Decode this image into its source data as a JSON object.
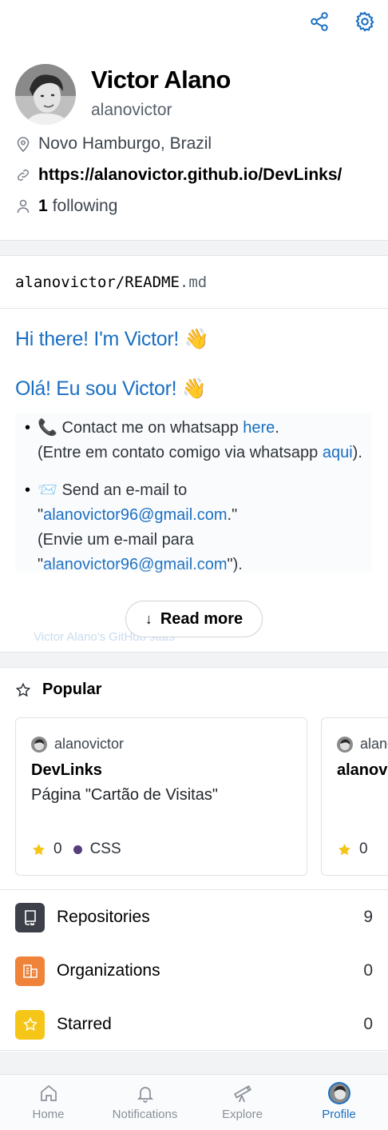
{
  "header": {
    "share_icon": "share-icon",
    "settings_icon": "gear-icon"
  },
  "profile": {
    "name": "Victor Alano",
    "username": "alanovictor",
    "location": "Novo Hamburgo, Brazil",
    "website": "https://alanovictor.github.io/DevLinks/",
    "following_count": "1",
    "following_label": "following"
  },
  "readme": {
    "path_main": "alanovictor/README",
    "path_ext": ".md",
    "heading_en": "Hi there! I'm Victor! 👋",
    "heading_pt": "Olá! Eu sou Victor! 👋",
    "item1_prefix": "📞 Contact me on whatsapp ",
    "item1_link": "here",
    "item1_after": ".",
    "item1_line2_prefix": "(Entre em contato comigo via whatsapp ",
    "item1_line2_link": "aqui",
    "item1_line2_after": ").",
    "item2_prefix": "📨 Send an e-mail to \"",
    "item2_link": "alanovictor96@gmail.com",
    "item2_after": ".\"",
    "item2_line2_prefix": "(Envie um e-mail para \"",
    "item2_line2_link": "alanovictor96@gmail.com",
    "item2_line2_after": "\").",
    "faded_text": "Victor Alano's GitHub stats",
    "read_more_label": "Read more"
  },
  "popular": {
    "title": "Popular",
    "cards": [
      {
        "owner": "alanovictor",
        "name": "DevLinks",
        "description": "Página \"Cartão de Visitas\"",
        "stars": "0",
        "language": "CSS",
        "language_color": "#563d7c"
      },
      {
        "owner": "alanovictor",
        "name": "alanovictor",
        "description": "",
        "stars": "0",
        "language": "",
        "language_color": ""
      }
    ]
  },
  "menu": {
    "items": [
      {
        "label": "Repositories",
        "count": "9",
        "color": "#3d4048",
        "icon": "repo-icon"
      },
      {
        "label": "Organizations",
        "count": "0",
        "color": "#f0833a",
        "icon": "organization-icon"
      },
      {
        "label": "Starred",
        "count": "0",
        "color": "#f5c518",
        "icon": "star-icon"
      }
    ]
  },
  "tabbar": {
    "tabs": [
      {
        "label": "Home",
        "icon": "home-icon"
      },
      {
        "label": "Notifications",
        "icon": "bell-icon"
      },
      {
        "label": "Explore",
        "icon": "telescope-icon"
      },
      {
        "label": "Profile",
        "icon": "avatar"
      }
    ],
    "active": "Profile",
    "accent": "#1a6fc2"
  }
}
